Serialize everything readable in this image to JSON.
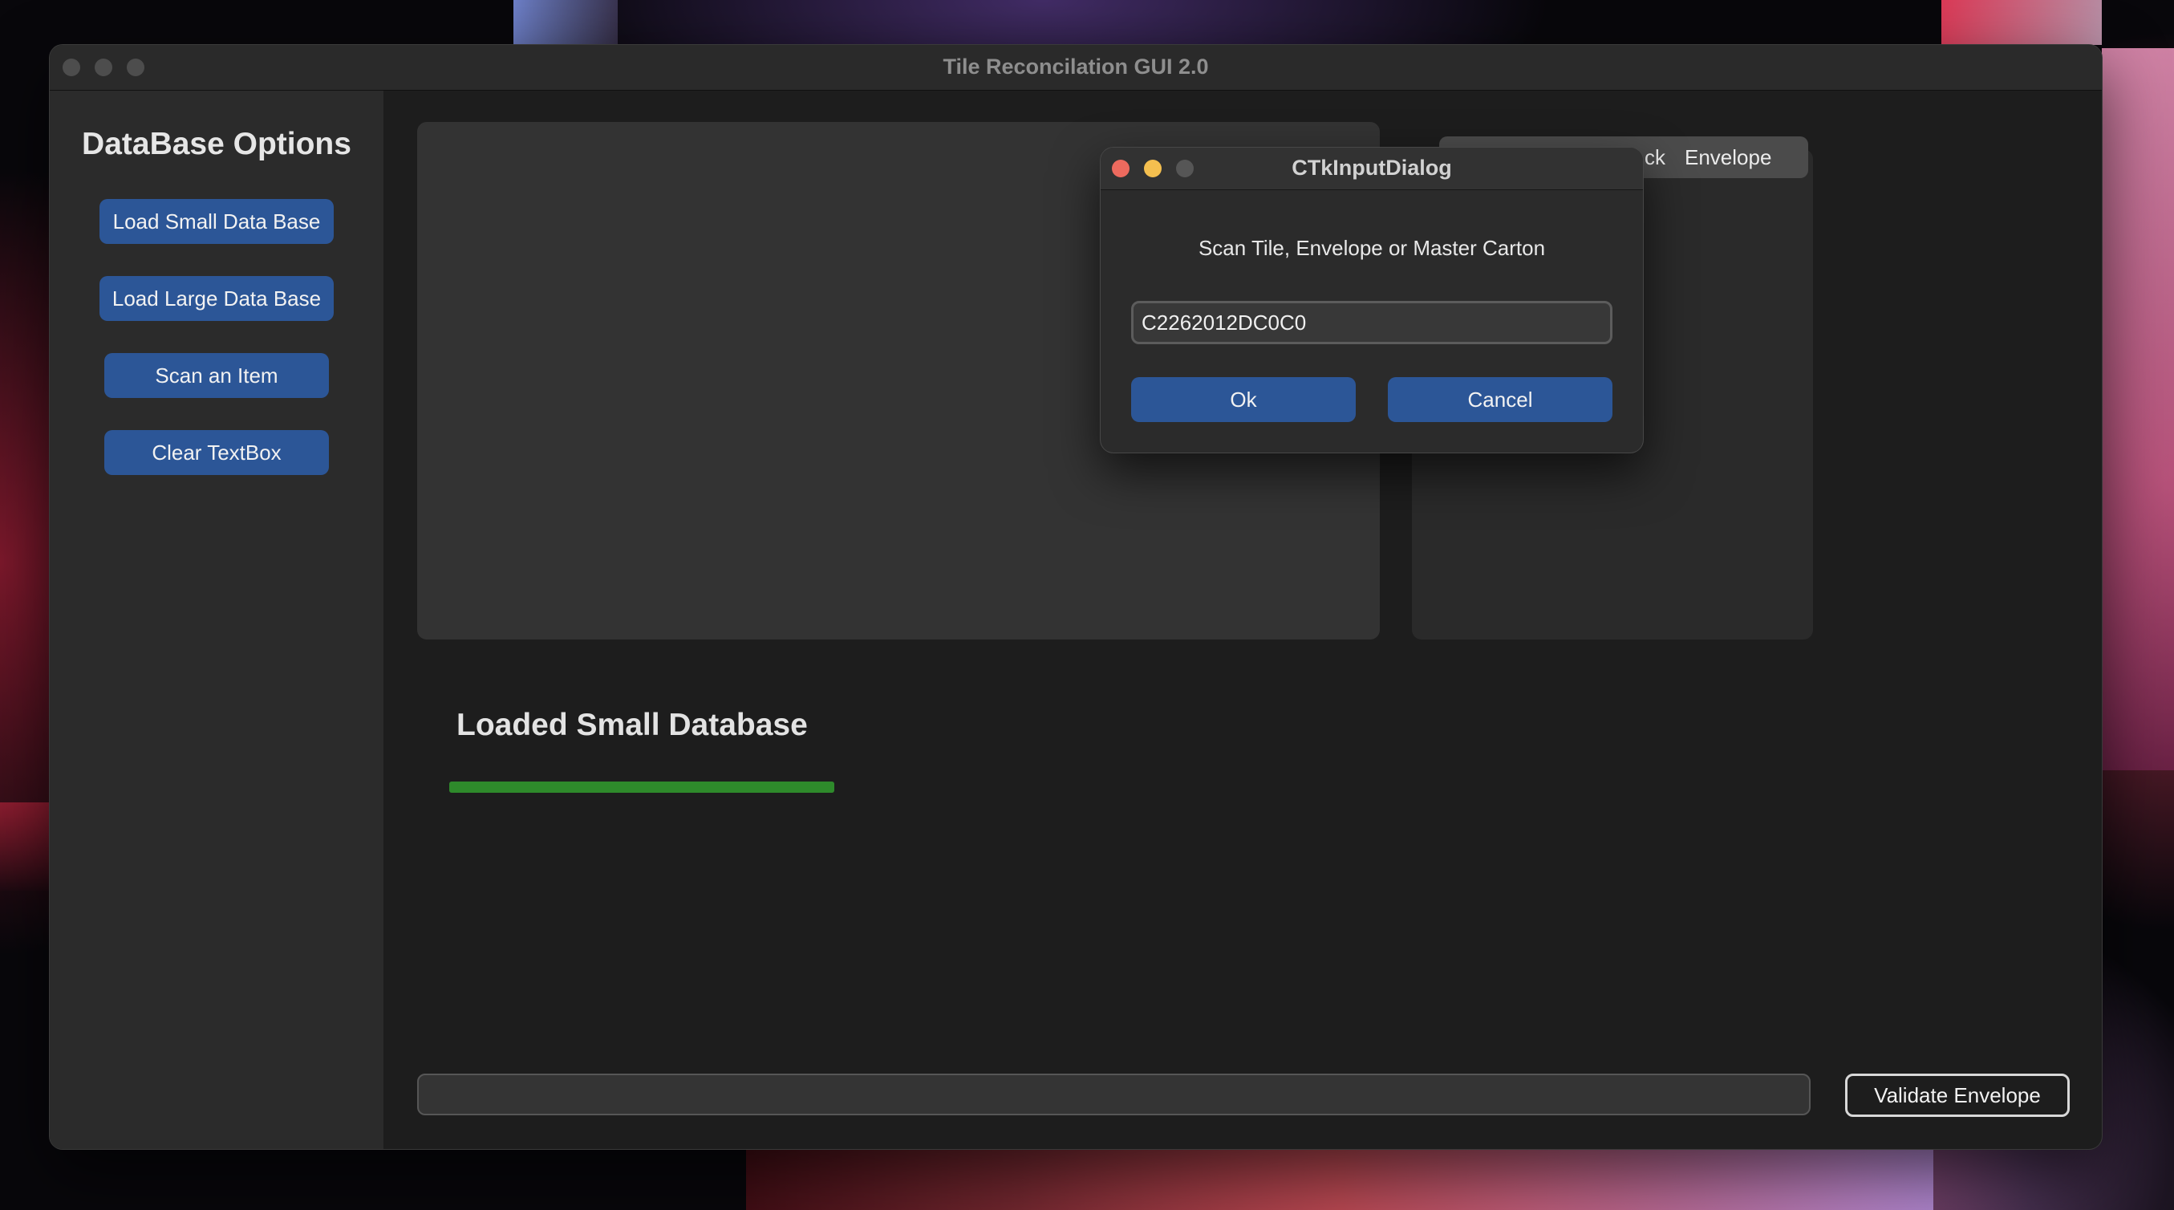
{
  "window": {
    "title": "Tile Reconcilation GUI 2.0"
  },
  "sidebar": {
    "title": "DataBase Options",
    "buttons": [
      {
        "label": "Load Small Data Base"
      },
      {
        "label": "Load Large Data Base"
      },
      {
        "label": "Scan an Item"
      },
      {
        "label": "Clear TextBox"
      }
    ]
  },
  "tabs": {
    "visible_labels": [
      "ck",
      "Envelope"
    ]
  },
  "status": {
    "label": "Loaded Small Database",
    "progress": 1.0
  },
  "bottom": {
    "entry_value": "",
    "validate_label": "Validate Envelope"
  },
  "dialog": {
    "title": "CTkInputDialog",
    "prompt": "Scan Tile, Envelope or Master Carton",
    "input_value": "C2262012DC0C0",
    "ok_label": "Ok",
    "cancel_label": "Cancel"
  },
  "colors": {
    "accent_button": "#2c5697",
    "progress_fill": "#2e8a2b",
    "close_red": "#ed6a5e",
    "minimize_yellow": "#f4bf4f",
    "disabled_gray": "#4d4d4d"
  }
}
